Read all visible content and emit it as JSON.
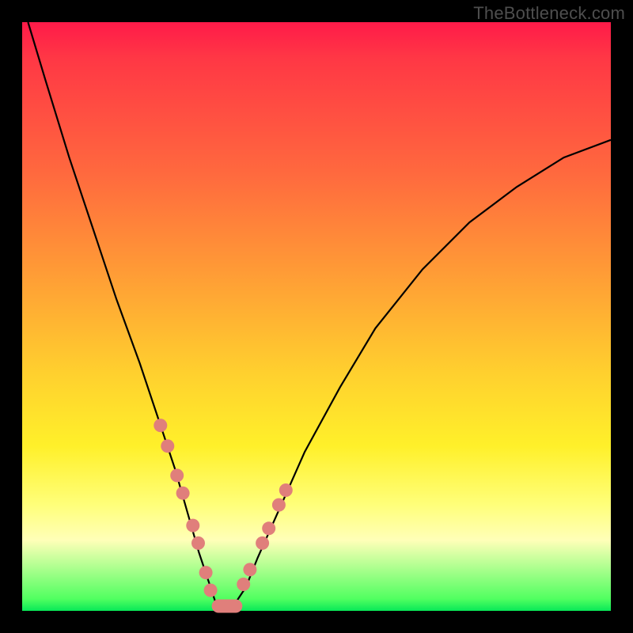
{
  "watermark": "TheBottleneck.com",
  "colors": {
    "frame": "#000000",
    "curve": "#000000",
    "dots": "#e07f7b",
    "gradient_stops": [
      "#ff1a49",
      "#ff3745",
      "#ff6a3e",
      "#ff9a36",
      "#ffd12e",
      "#fff02a",
      "#ffff7a",
      "#ffffb8",
      "#50ff60",
      "#08e858"
    ]
  },
  "chart_data": {
    "type": "line",
    "title": "",
    "xlabel": "",
    "ylabel": "",
    "xlim": [
      0,
      100
    ],
    "ylim": [
      0,
      100
    ],
    "grid": false,
    "legend": false,
    "notes": "V-shaped bottleneck curve over red→green gradient; y=0 (green) is optimal, y=100 (red) is worst. No axis ticks or numeric labels are rendered in the image.",
    "series": [
      {
        "name": "bottleneck-curve",
        "x": [
          1,
          4,
          8,
          12,
          16,
          20,
          24,
          26,
          28,
          30,
          32,
          33,
          34,
          35,
          36,
          38,
          40,
          44,
          48,
          54,
          60,
          68,
          76,
          84,
          92,
          100
        ],
        "y": [
          100,
          90,
          77,
          65,
          53,
          42,
          30,
          24,
          17,
          10,
          4,
          1,
          0,
          0,
          1,
          4,
          9,
          18,
          27,
          38,
          48,
          58,
          66,
          72,
          77,
          80
        ]
      }
    ],
    "markers": [
      {
        "name": "dots-left-branch",
        "x": [
          23.5,
          24.7,
          26.3,
          27.3,
          29.0,
          29.9,
          31.2,
          32.0
        ],
        "y": [
          31.5,
          28.0,
          23.0,
          20.0,
          14.5,
          11.5,
          6.5,
          3.5
        ]
      },
      {
        "name": "dots-right-branch",
        "x": [
          37.6,
          38.7,
          40.8,
          41.9,
          43.6,
          44.8
        ],
        "y": [
          4.5,
          7.0,
          11.5,
          14.0,
          18.0,
          20.5
        ]
      },
      {
        "name": "bottom-flat-marker",
        "shape": "rounded-bar",
        "x_range": [
          32.2,
          37.4
        ],
        "y": 0.8
      }
    ]
  }
}
